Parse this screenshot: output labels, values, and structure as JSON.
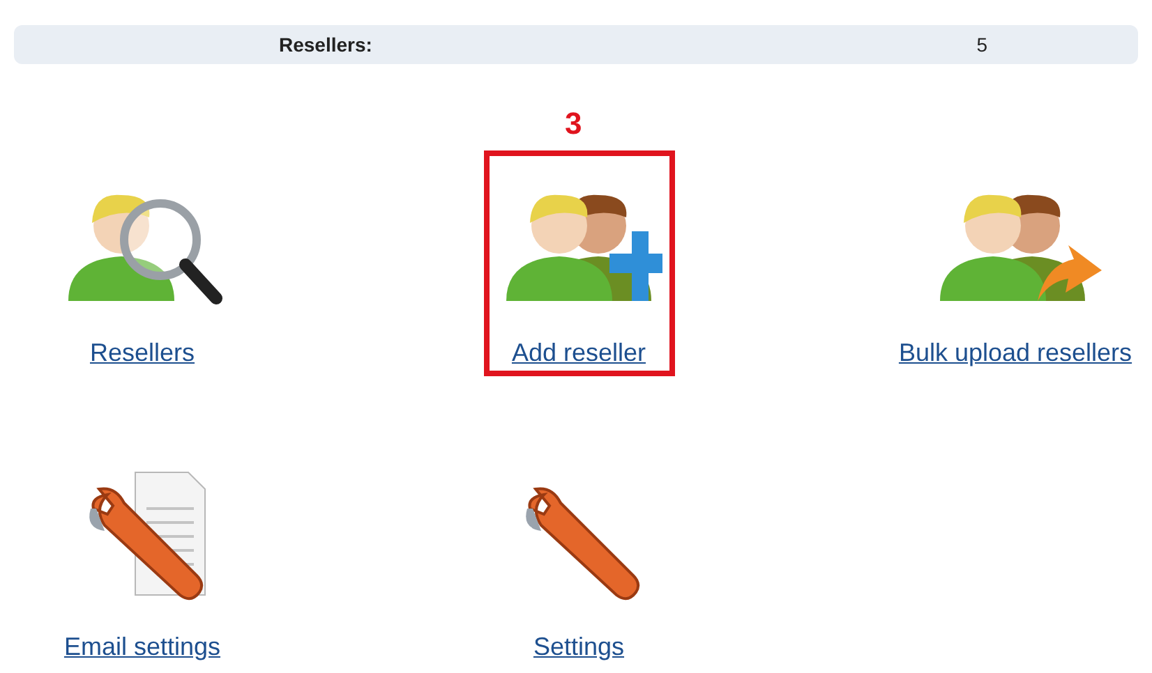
{
  "summary": {
    "label": "Resellers:",
    "value": "5"
  },
  "tile_rows": [
    [
      {
        "kind": "search",
        "label": "Resellers",
        "highlighted": false
      },
      {
        "kind": "add",
        "label": "Add reseller",
        "highlighted": true,
        "annotation": "3"
      },
      {
        "kind": "upload",
        "label": "Bulk upload resellers",
        "highlighted": false
      }
    ],
    [
      {
        "kind": "email",
        "label": "Email settings",
        "highlighted": false
      },
      {
        "kind": "settings",
        "label": "Settings",
        "highlighted": false
      }
    ]
  ]
}
